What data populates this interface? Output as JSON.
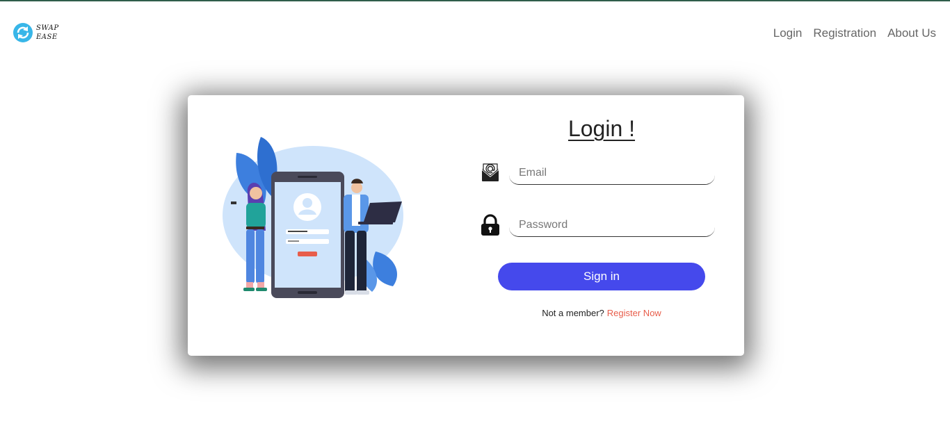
{
  "brand": {
    "line1": "SWAP",
    "line2": "EASE",
    "logo_icon": "refresh-arrows-icon",
    "logo_color": "#38b6e8"
  },
  "nav": {
    "items": [
      {
        "label": "Login"
      },
      {
        "label": "Registration"
      },
      {
        "label": "About Us"
      }
    ]
  },
  "login": {
    "title": "Login !",
    "email": {
      "placeholder": "Email",
      "icon": "envelope-at-icon"
    },
    "password": {
      "placeholder": "Password",
      "icon": "padlock-icon"
    },
    "signin_label": "Sign in",
    "prompt": "Not a member?",
    "register_label": "Register Now"
  },
  "colors": {
    "accent": "#4549ec",
    "link": "#e85d4a",
    "top_border": "#2f5d4a"
  }
}
